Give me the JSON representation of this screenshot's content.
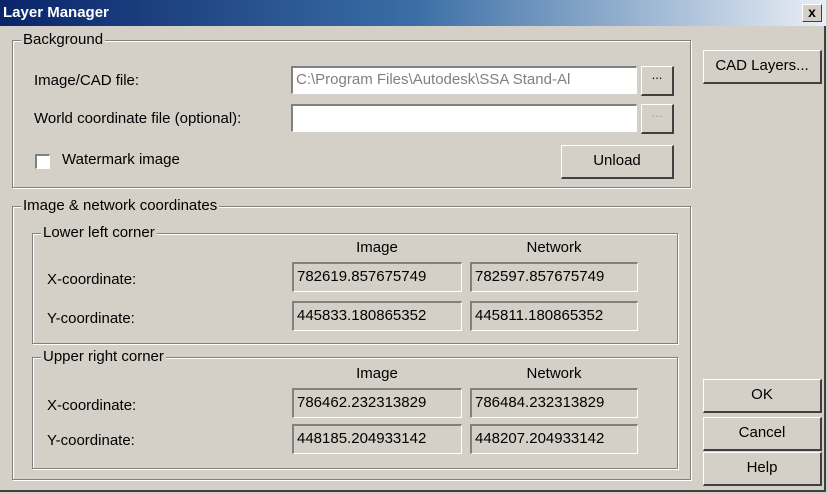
{
  "window": {
    "title": "Layer Manager",
    "close_label": "x"
  },
  "background": {
    "legend": "Background",
    "image_file_label": "Image/CAD file:",
    "image_file_value": "C:\\Program Files\\Autodesk\\SSA Stand-Al",
    "browse_label": "...",
    "world_file_label": "World coordinate file (optional):",
    "world_file_value": "",
    "world_browse_label": "...",
    "watermark_label": "Watermark image",
    "watermark_checked": false,
    "unload_label": "Unload"
  },
  "coords": {
    "legend": "Image & network coordinates",
    "lower_left": {
      "legend": "Lower left corner",
      "col_image": "Image",
      "col_network": "Network",
      "x_label": "X-coordinate:",
      "y_label": "Y-coordinate:",
      "x_image": "782619.857675749",
      "x_network": "782597.857675749",
      "y_image": "445833.180865352",
      "y_network": "445811.180865352"
    },
    "upper_right": {
      "legend": "Upper right corner",
      "col_image": "Image",
      "col_network": "Network",
      "x_label": "X-coordinate:",
      "y_label": "Y-coordinate:",
      "x_image": "786462.232313829",
      "x_network": "786484.232313829",
      "y_image": "448185.204933142",
      "y_network": "448207.204933142"
    }
  },
  "buttons": {
    "cad_layers": "CAD Layers...",
    "ok": "OK",
    "cancel": "Cancel",
    "help": "Help"
  }
}
